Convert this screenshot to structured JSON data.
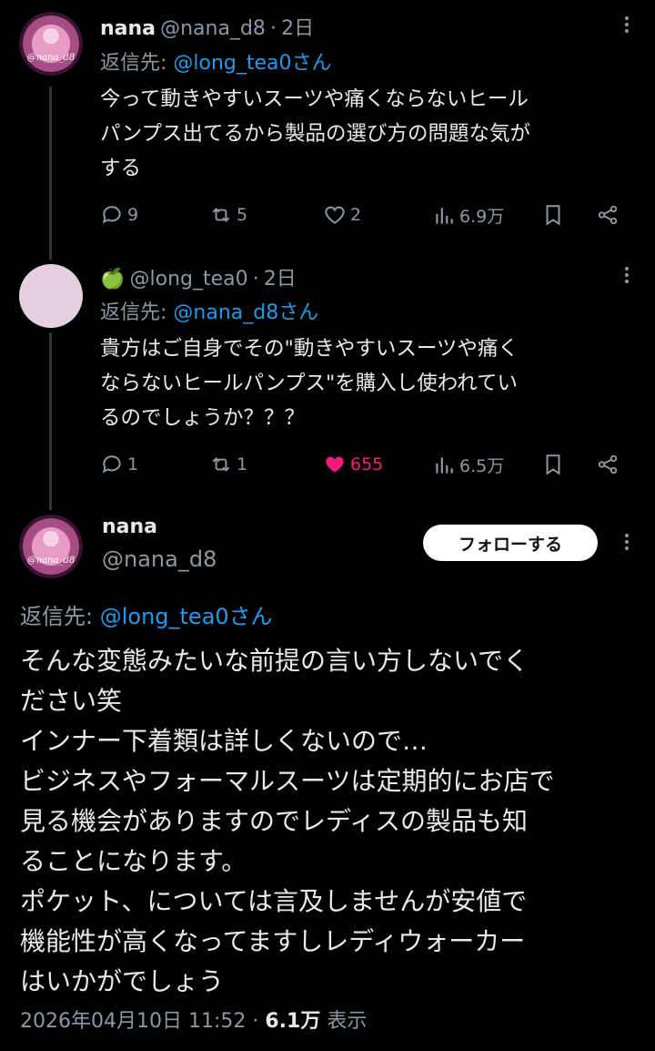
{
  "tweet1": {
    "name": "nana",
    "handle": "@nana_d8",
    "sep": "·",
    "time": "2日",
    "reply_prefix": "返信先: ",
    "reply_to": "@long_tea0さん",
    "lines": [
      "今って動きやすいスーツや痛くならないヒール",
      "パンプス出てるから製品の選び方の問題な気が",
      "する"
    ],
    "replies": "9",
    "retweets": "5",
    "likes": "2",
    "views": "6.9万"
  },
  "tweet2": {
    "emoji": "🍏",
    "handle": "@long_tea0",
    "sep": "·",
    "time": "2日",
    "reply_prefix": "返信先: ",
    "reply_to": "@nana_d8さん",
    "lines": [
      "貴方はご自身でその\"動きやすいスーツや痛く",
      "ならないヒールパンプス\"を購入し使われてい",
      "るのでしょうか？？？"
    ],
    "replies": "1",
    "retweets": "1",
    "likes": "655",
    "views": "6.5万"
  },
  "main": {
    "name": "nana",
    "handle": "@nana_d8",
    "follow_label": "フォローする",
    "reply_prefix": "返信先: ",
    "reply_to": "@long_tea0さん",
    "lines": [
      "そんな変態みたいな前提の言い方しないでく",
      "ださい笑",
      "インナー下着類は詳しくないので…",
      "ビジネスやフォーマルスーツは定期的にお店で",
      "見る機会がありますのでレディスの製品も知",
      "ることになります。",
      "ポケット、については言及しませんが安値で",
      "機能性が高くなってますしレディウォーカー",
      "はいかがでしょう"
    ],
    "timestamp": "2026年04月10日 11:52",
    "sep": "·",
    "views_count": "6.1万",
    "views_label": "表示"
  },
  "colors": {
    "like_active": "#f91880",
    "link": "#1d9bf0",
    "muted": "#8b98a5"
  }
}
